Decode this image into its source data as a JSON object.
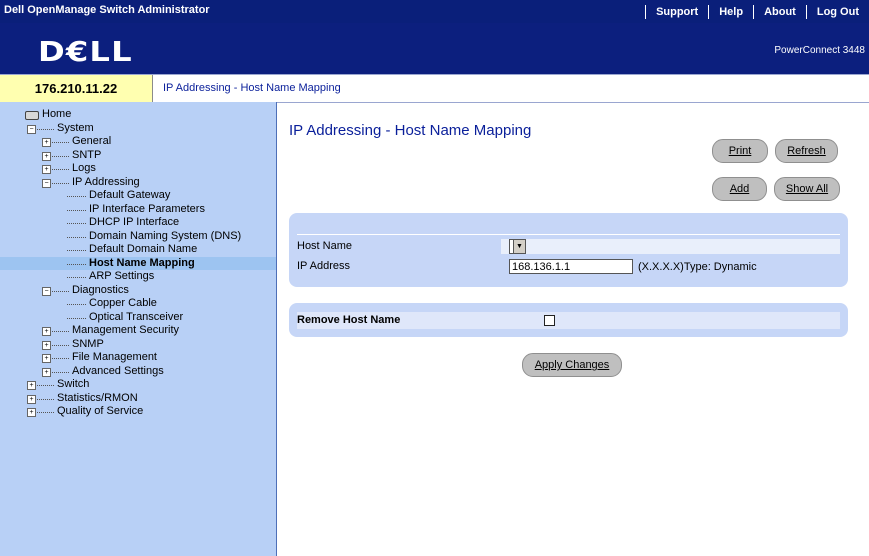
{
  "app": {
    "title": "Dell OpenManage Switch Administrator",
    "nav": [
      "Support",
      "Help",
      "About",
      "Log Out"
    ],
    "logo_text": "D€LL",
    "product": "PowerConnect 3448"
  },
  "address": {
    "ip": "176.210.11.22",
    "breadcrumb": "IP Addressing - Host Name Mapping"
  },
  "tree": [
    {
      "label": "Home",
      "depth": 0,
      "type": "root"
    },
    {
      "label": "System",
      "depth": 1,
      "type": "expanded"
    },
    {
      "label": "General",
      "depth": 2,
      "type": "collapsed"
    },
    {
      "label": "SNTP",
      "depth": 2,
      "type": "collapsed"
    },
    {
      "label": "Logs",
      "depth": 2,
      "type": "collapsed"
    },
    {
      "label": "IP Addressing",
      "depth": 2,
      "type": "expanded"
    },
    {
      "label": "Default Gateway",
      "depth": 3,
      "type": "leaf"
    },
    {
      "label": "IP Interface Parameters",
      "depth": 3,
      "type": "leaf"
    },
    {
      "label": "DHCP IP Interface",
      "depth": 3,
      "type": "leaf"
    },
    {
      "label": "Domain Naming System (DNS)",
      "depth": 3,
      "type": "leaf"
    },
    {
      "label": "Default Domain Name",
      "depth": 3,
      "type": "leaf"
    },
    {
      "label": "Host Name Mapping",
      "depth": 3,
      "type": "leaf",
      "selected": true
    },
    {
      "label": "ARP Settings",
      "depth": 3,
      "type": "leaf"
    },
    {
      "label": "Diagnostics",
      "depth": 2,
      "type": "expanded"
    },
    {
      "label": "Copper Cable",
      "depth": 3,
      "type": "leaf"
    },
    {
      "label": "Optical Transceiver",
      "depth": 3,
      "type": "leaf"
    },
    {
      "label": "Management Security",
      "depth": 2,
      "type": "collapsed"
    },
    {
      "label": "SNMP",
      "depth": 2,
      "type": "collapsed"
    },
    {
      "label": "File Management",
      "depth": 2,
      "type": "collapsed"
    },
    {
      "label": "Advanced Settings",
      "depth": 2,
      "type": "collapsed"
    },
    {
      "label": "Switch",
      "depth": 1,
      "type": "collapsed"
    },
    {
      "label": "Statistics/RMON",
      "depth": 1,
      "type": "collapsed"
    },
    {
      "label": "Quality of Service",
      "depth": 1,
      "type": "collapsed"
    }
  ],
  "page": {
    "title": "IP Addressing - Host Name Mapping",
    "buttons": {
      "print": "Print",
      "refresh": "Refresh",
      "add": "Add",
      "show_all": "Show All",
      "apply": "Apply Changes"
    },
    "fields": {
      "host_name_label": "Host Name",
      "host_name_value": "",
      "ip_label": "IP Address",
      "ip_value": "168.136.1.1",
      "ip_hint": "(X.X.X.X)Type: Dynamic"
    },
    "remove": {
      "label": "Remove Host Name",
      "checked": false
    }
  }
}
